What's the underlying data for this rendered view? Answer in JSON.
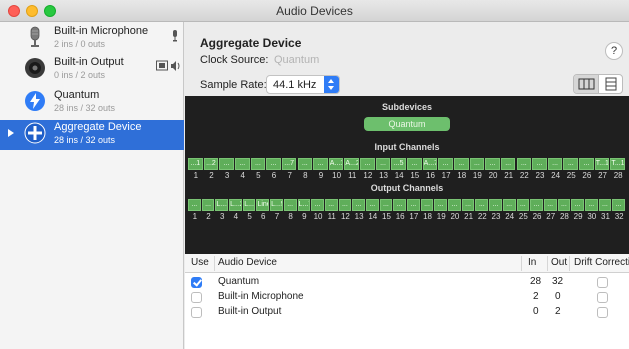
{
  "window": {
    "title": "Audio Devices"
  },
  "sidebar": {
    "devices": [
      {
        "name": "Built-in Microphone",
        "sub": "2 ins / 0 outs",
        "icon": "microphone-icon"
      },
      {
        "name": "Built-in Output",
        "sub": "0 ins / 2 outs",
        "icon": "speaker-icon"
      },
      {
        "name": "Quantum",
        "sub": "28 ins / 32 outs",
        "icon": "thunderbolt-icon"
      },
      {
        "name": "Aggregate Device",
        "sub": "28 ins / 32 outs",
        "icon": "aggregate-plus-icon",
        "selected": true
      }
    ]
  },
  "main": {
    "device_title": "Aggregate Device",
    "clock_label": "Clock Source:",
    "clock_value": "Quantum",
    "help_label": "?",
    "sample_rate_label": "Sample Rate:",
    "sample_rate_value": "44.1 kHz"
  },
  "panel": {
    "subdevices_title": "Subdevices",
    "subdevice": "Quantum",
    "input_title": "Input Channels",
    "input_labels": [
      "...1",
      "...2",
      "...",
      "...",
      "...",
      "...",
      "...7",
      "...",
      "...",
      "A...1",
      "A...2",
      "...",
      "...",
      "...5",
      "...",
      "A...7",
      "...",
      "...",
      "...",
      "...",
      "...",
      "...",
      "...",
      "...",
      "...",
      "...",
      "T...1",
      "T...1"
    ],
    "input_numbers": [
      "1",
      "2",
      "3",
      "4",
      "5",
      "6",
      "7",
      "8",
      "9",
      "10",
      "11",
      "12",
      "13",
      "14",
      "15",
      "16",
      "17",
      "18",
      "19",
      "20",
      "21",
      "22",
      "23",
      "24",
      "25",
      "26",
      "27",
      "28"
    ],
    "output_title": "Output Channels",
    "output_labels": [
      "...",
      "...",
      "L...1",
      "L...2",
      "L...",
      "Line Out 4",
      "L...5",
      "...",
      "L...7",
      "...",
      "...",
      "...",
      "...",
      "...",
      "...",
      "...",
      "...",
      "...",
      "...",
      "...",
      "...",
      "...",
      "...",
      "...",
      "...",
      "...",
      "...",
      "...",
      "...",
      "...",
      "...",
      "..."
    ],
    "output_numbers": [
      "1",
      "2",
      "3",
      "4",
      "5",
      "6",
      "7",
      "8",
      "9",
      "10",
      "11",
      "12",
      "13",
      "14",
      "15",
      "16",
      "17",
      "18",
      "19",
      "20",
      "21",
      "22",
      "23",
      "24",
      "25",
      "26",
      "27",
      "28",
      "29",
      "30",
      "31",
      "32"
    ]
  },
  "table": {
    "headers": {
      "use": "Use",
      "device": "Audio Device",
      "in": "In",
      "out": "Out",
      "drift": "Drift Correction"
    },
    "rows": [
      {
        "use": true,
        "device": "Quantum",
        "in": "28",
        "out": "32"
      },
      {
        "use": false,
        "device": "Built-in Microphone",
        "in": "2",
        "out": "0"
      },
      {
        "use": false,
        "device": "Built-in Output",
        "in": "0",
        "out": "2"
      }
    ]
  },
  "colors": {
    "selection": "#2f6fd8",
    "channel": "#5fae5a",
    "panel_bg": "#1f1f1f",
    "accent": "#2f7cf6"
  }
}
